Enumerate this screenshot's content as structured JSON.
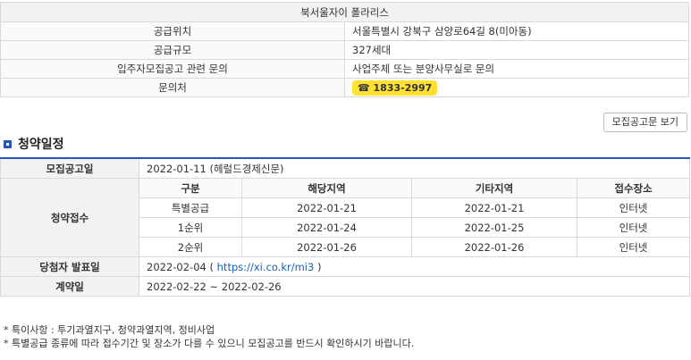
{
  "info": {
    "title": "북서울자이 폴라리스",
    "rows": [
      {
        "label": "공급위치",
        "value": "서울특별시 강북구 삼양로64길 8(미아동)"
      },
      {
        "label": "공급규모",
        "value": "327세대"
      },
      {
        "label": "입주자모집공고 관련 문의",
        "value": "사업주체 또는 분양사무실로 문의"
      },
      {
        "label": "문의처",
        "value": "☎ 1833-2997"
      }
    ]
  },
  "notice_button": "모집공고문 보기",
  "section": {
    "title": "청약일정"
  },
  "schedule": {
    "recruit_label": "모집공고일",
    "recruit_value": "2022-01-11 (헤럴드경제신문)",
    "apply_label": "청약접수",
    "apply_headers": [
      "구분",
      "해당지역",
      "기타지역",
      "접수장소"
    ],
    "apply_rows": [
      [
        "특별공급",
        "2022-01-21",
        "2022-01-21",
        "인터넷"
      ],
      [
        "1순위",
        "2022-01-24",
        "2022-01-25",
        "인터넷"
      ],
      [
        "2순위",
        "2022-01-26",
        "2022-01-26",
        "인터넷"
      ]
    ],
    "winner_label": "당첨자 발표일",
    "winner_date": "2022-02-04 (",
    "winner_link": "https://xi.co.kr/mi3",
    "winner_close": ")",
    "contract_label": "계약일",
    "contract_value": "2022-02-22 ~ 2022-02-26"
  },
  "notes": [
    "* 특이사항 : 투기과열지구, 청약과열지역, 정비사업",
    "* 특별공급 종류에 따라 접수기간 및 장소가 다를 수 있으니 모집공고를 반드시 확인하시기 바랍니다."
  ],
  "colors": {
    "accent": "#2857b6",
    "phone_badge": "#ffe033",
    "link": "#1a5fb4"
  }
}
